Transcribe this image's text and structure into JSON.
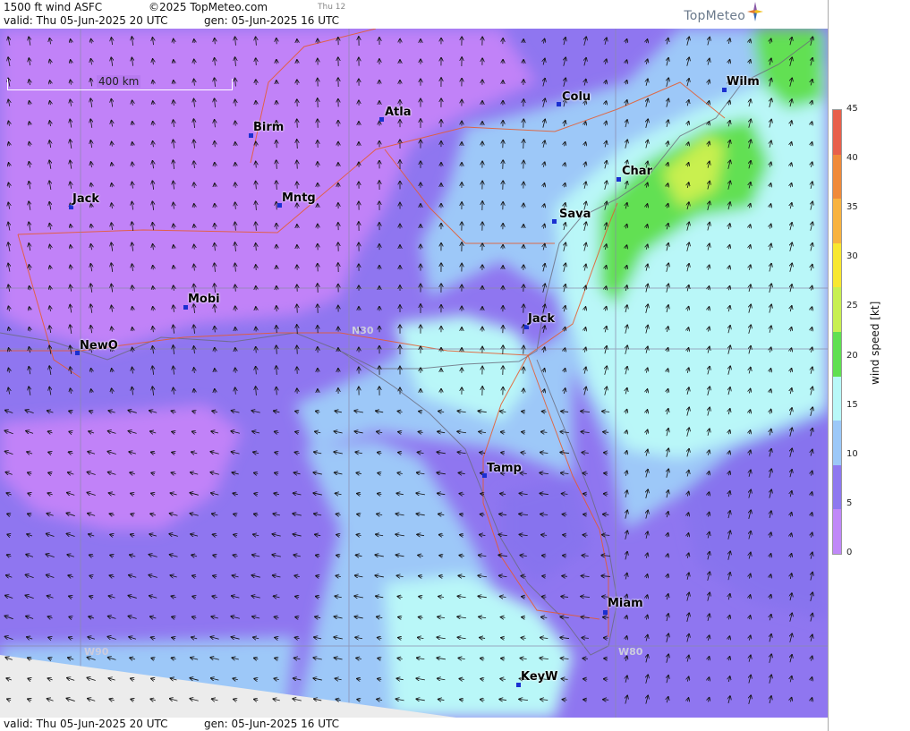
{
  "header": {
    "product": "1500 ft wind ASFC",
    "copyright": "©2025 TopMeteo.com",
    "run_tag": "Thu 12",
    "valid": "valid:  Thu  05-Jun-2025  20 UTC",
    "gen": "gen: 05-Jun-2025 16 UTC"
  },
  "footer": {
    "valid": "valid:  Thu  05-Jun-2025  20 UTC",
    "gen": "gen: 05-Jun-2025 16 UTC"
  },
  "logo": {
    "text": "TopMeteo"
  },
  "map": {
    "scale_label": "400 km",
    "grid_labels": {
      "lat": "N30",
      "lon_w90": "W90",
      "lon_w80": "W80"
    },
    "cities": [
      {
        "name": "Wilm"
      },
      {
        "name": "Colu"
      },
      {
        "name": "Atla"
      },
      {
        "name": "Birm"
      },
      {
        "name": "Char"
      },
      {
        "name": "Jack"
      },
      {
        "name": "Mntg"
      },
      {
        "name": "Sava"
      },
      {
        "name": "Mobi"
      },
      {
        "name": "Jack"
      },
      {
        "name": "NewO"
      },
      {
        "name": "Tamp"
      },
      {
        "name": "Miam"
      },
      {
        "name": "KeyW"
      }
    ]
  },
  "legend": {
    "label": "wind speed [kt]",
    "ticks": [
      "45",
      "40",
      "35",
      "30",
      "25",
      "20",
      "15",
      "10",
      "5",
      "0"
    ],
    "colors": [
      "#e8604c",
      "#f08a3a",
      "#f8b340",
      "#f8e830",
      "#c8f050",
      "#60e050",
      "#b8f8f8",
      "#9cc8f8",
      "#8e78f0",
      "#c088f8"
    ]
  }
}
